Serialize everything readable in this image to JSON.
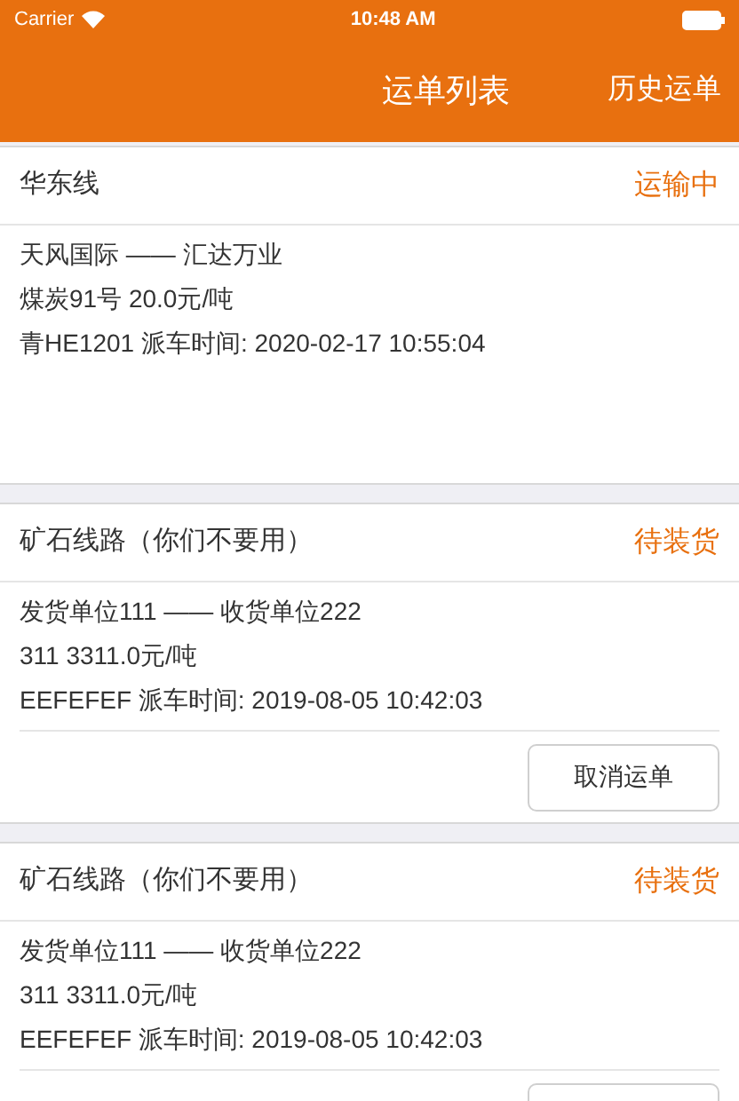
{
  "status_bar": {
    "carrier": "Carrier",
    "time": "10:48 AM"
  },
  "nav": {
    "title": "运单列表",
    "action": "历史运单"
  },
  "orders": [
    {
      "kind": "plain",
      "route": "华东线",
      "status": "运输中",
      "lines": [
        "天风国际 —— 汇达万业",
        "煤炭91号  20.0元/吨",
        "青HE1201  派车时间: 2020-02-17 10:55:04"
      ]
    },
    {
      "kind": "with_button",
      "route": "矿石线路（你们不要用）",
      "status": "待装货",
      "lines": [
        "发货单位111 —— 收货单位222",
        "311  3311.0元/吨",
        "EEFEFEF  派车时间: 2019-08-05 10:42:03"
      ],
      "button_label": "取消运单"
    },
    {
      "kind": "with_button",
      "route": "矿石线路（你们不要用）",
      "status": "待装货",
      "lines": [
        "发货单位111 —— 收货单位222",
        "311  3311.0元/吨",
        "EEFEFEF  派车时间: 2019-08-05 10:42:03"
      ]
    }
  ]
}
